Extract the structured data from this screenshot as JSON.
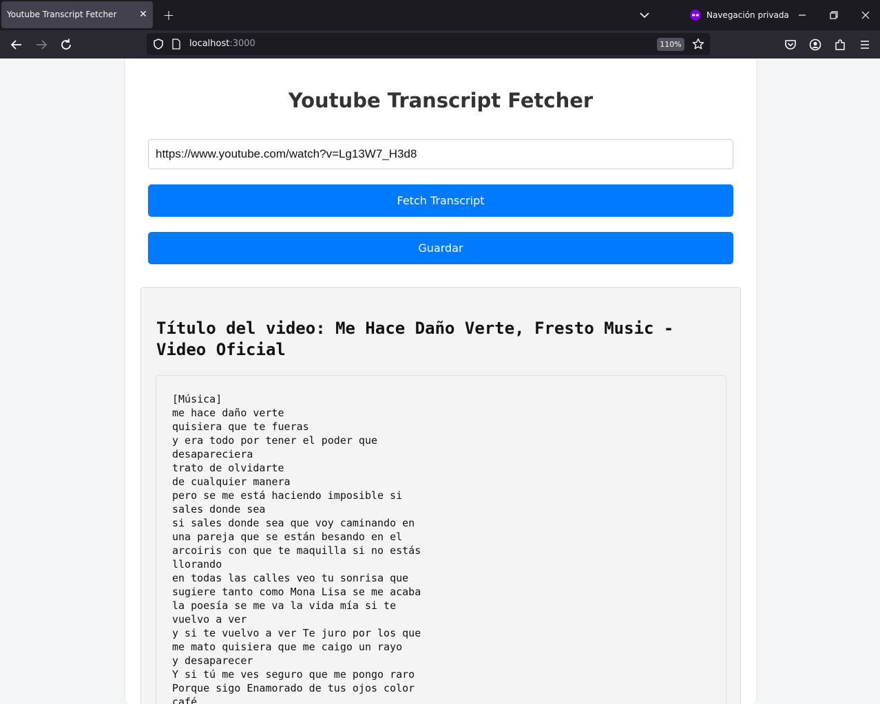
{
  "browser": {
    "tab_title": "Youtube Transcript Fetcher",
    "private_label": "Navegación privada",
    "url_host": "localhost",
    "url_port": ":3000",
    "zoom": "110%"
  },
  "page": {
    "title": "Youtube Transcript Fetcher",
    "url_input_value": "https://www.youtube.com/watch?v=Lg13W7_H3d8",
    "fetch_button": "Fetch Transcript",
    "save_button": "Guardar",
    "video_title_line1": "Título del video: Me Hace Daño Verte, Fresto Music -",
    "video_title_line2": "Video Oficial",
    "transcript_lines": [
      "[Música]",
      "me hace daño verte",
      "quisiera que te fueras",
      "y era todo por tener el poder que",
      "desapareciera",
      "trato de olvidarte",
      "de cualquier manera",
      "pero se me está haciendo imposible si",
      "sales donde sea",
      "si sales donde sea que voy caminando en",
      "una pareja que se están besando en el",
      "arcoiris con que te maquilla si no estás",
      "llorando",
      "en todas las calles veo tu sonrisa que",
      "sugiere tanto como Mona Lisa se me acaba",
      "la poesía se me va la vida mía si te",
      "vuelvo a ver",
      "y si te vuelvo a ver Te juro por los que",
      "me mato quisiera que me caigo un rayo",
      "y desaparecer",
      "Y si tú me ves seguro que me pongo raro",
      "Porque sigo Enamorado de tus ojos color",
      "café"
    ]
  },
  "colors": {
    "accent": "#007bff",
    "private_icon": "#8000d7"
  }
}
